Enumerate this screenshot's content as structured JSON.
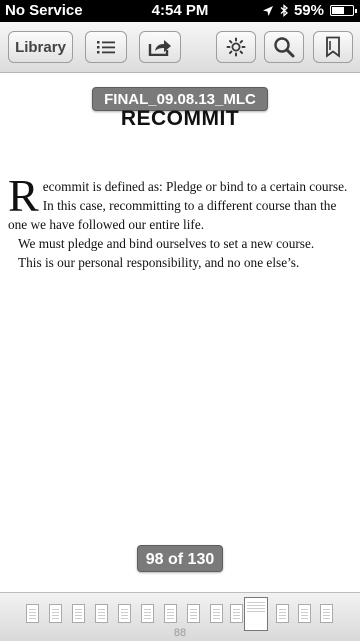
{
  "status_bar": {
    "carrier": "No Service",
    "time": "4:54 PM",
    "battery": "59%",
    "battery_level": 0.59,
    "icons": [
      "location-arrow-icon",
      "bluetooth-icon",
      "battery-icon"
    ]
  },
  "toolbar": {
    "library_label": "Library",
    "icons": [
      "list-icon",
      "share-icon",
      "brightness-icon",
      "search-icon",
      "bookmark-icon"
    ]
  },
  "document": {
    "title": "FINAL_09.08.13_MLC",
    "chapter_heading": "RECOMMIT",
    "dropcap": "R",
    "para1": "ecommit is defined as: Pledge or bind to a certain course. In this case, recommitting to a different course than the one we have followed our entire life.",
    "para2": "We must pledge and bind ourselves to set a new course.",
    "para3": "This is our personal responsibility, and no one else’s."
  },
  "page_indicator": {
    "label": "98 of 130"
  },
  "scrubber": {
    "page_number": "88"
  }
}
